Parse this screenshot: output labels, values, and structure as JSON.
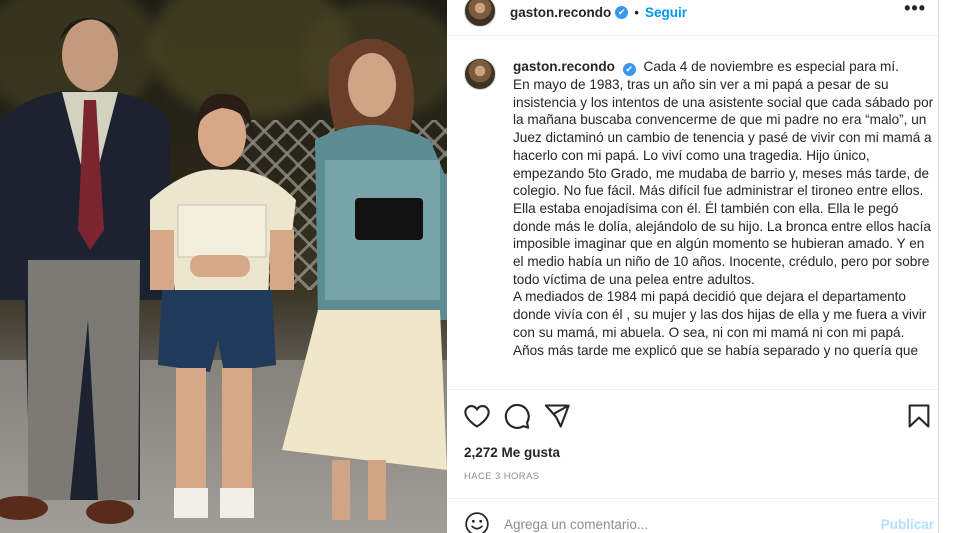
{
  "post": {
    "username": "gaston.recondo",
    "verified_mark": "✔",
    "separator": "•",
    "follow_label": "Seguir",
    "more_icon": "more-horizontal-icon",
    "more_label": "•••"
  },
  "caption": {
    "username": "gaston.recondo",
    "lines": [
      "Cada 4 de noviembre es especial para mí.",
      "En mayo de 1983, tras un año sin ver a mi papá a pesar de su insistencia y los intentos de una asistente social que cada sábado por la mañana buscaba convencerme de que mi padre no era “malo”, un Juez dictaminó un cambio de tenencia y pasé de vivir con mi mamá a hacerlo con mi papá. Lo viví como una tragedia. Hijo único, empezando 5to Grado, me mudaba de barrio y, meses más tarde, de colegio. No fue fácil. Más difícil fue administrar el tironeo entre ellos. Ella estaba enojadísima con él. Él también con ella. Ella le pegó donde más le dolía, alejándolo de su hijo. La bronca entre ellos hacía imposible imaginar que en algún momento se hubieran amado. Y en el medio había un niño de 10 años. Inocente, crédulo, pero por sobre todo víctima de una pelea entre adultos.",
      "A mediados de 1984 mi papá decidió que dejara el departamento donde vivía con él , su mujer y las dos hijas de ella y me fuera a vivir con su mamá, mi abuela. O sea, ni con mi mamá ni con mi papá. Años más tarde me explicó que se había separado y no quería que"
    ]
  },
  "actions": {
    "like_icon": "heart-icon",
    "comment_icon": "comment-bubble-icon",
    "share_icon": "paper-plane-icon",
    "save_icon": "bookmark-icon"
  },
  "likes": {
    "count_text": "2,272 Me gusta"
  },
  "timestamp": {
    "text": "HACE 3 HORAS"
  },
  "add_comment": {
    "emoji_icon": "smiley-icon",
    "placeholder": "Agrega un comentario...",
    "publish_label": "Publicar"
  },
  "colors": {
    "link_blue": "#0095f6",
    "publish_disabled": "#b2dffc",
    "verified_blue": "#3897f0",
    "muted_text": "#8e8e8e",
    "border": "#efefef"
  },
  "photo": {
    "description_icon": "post-photo"
  }
}
